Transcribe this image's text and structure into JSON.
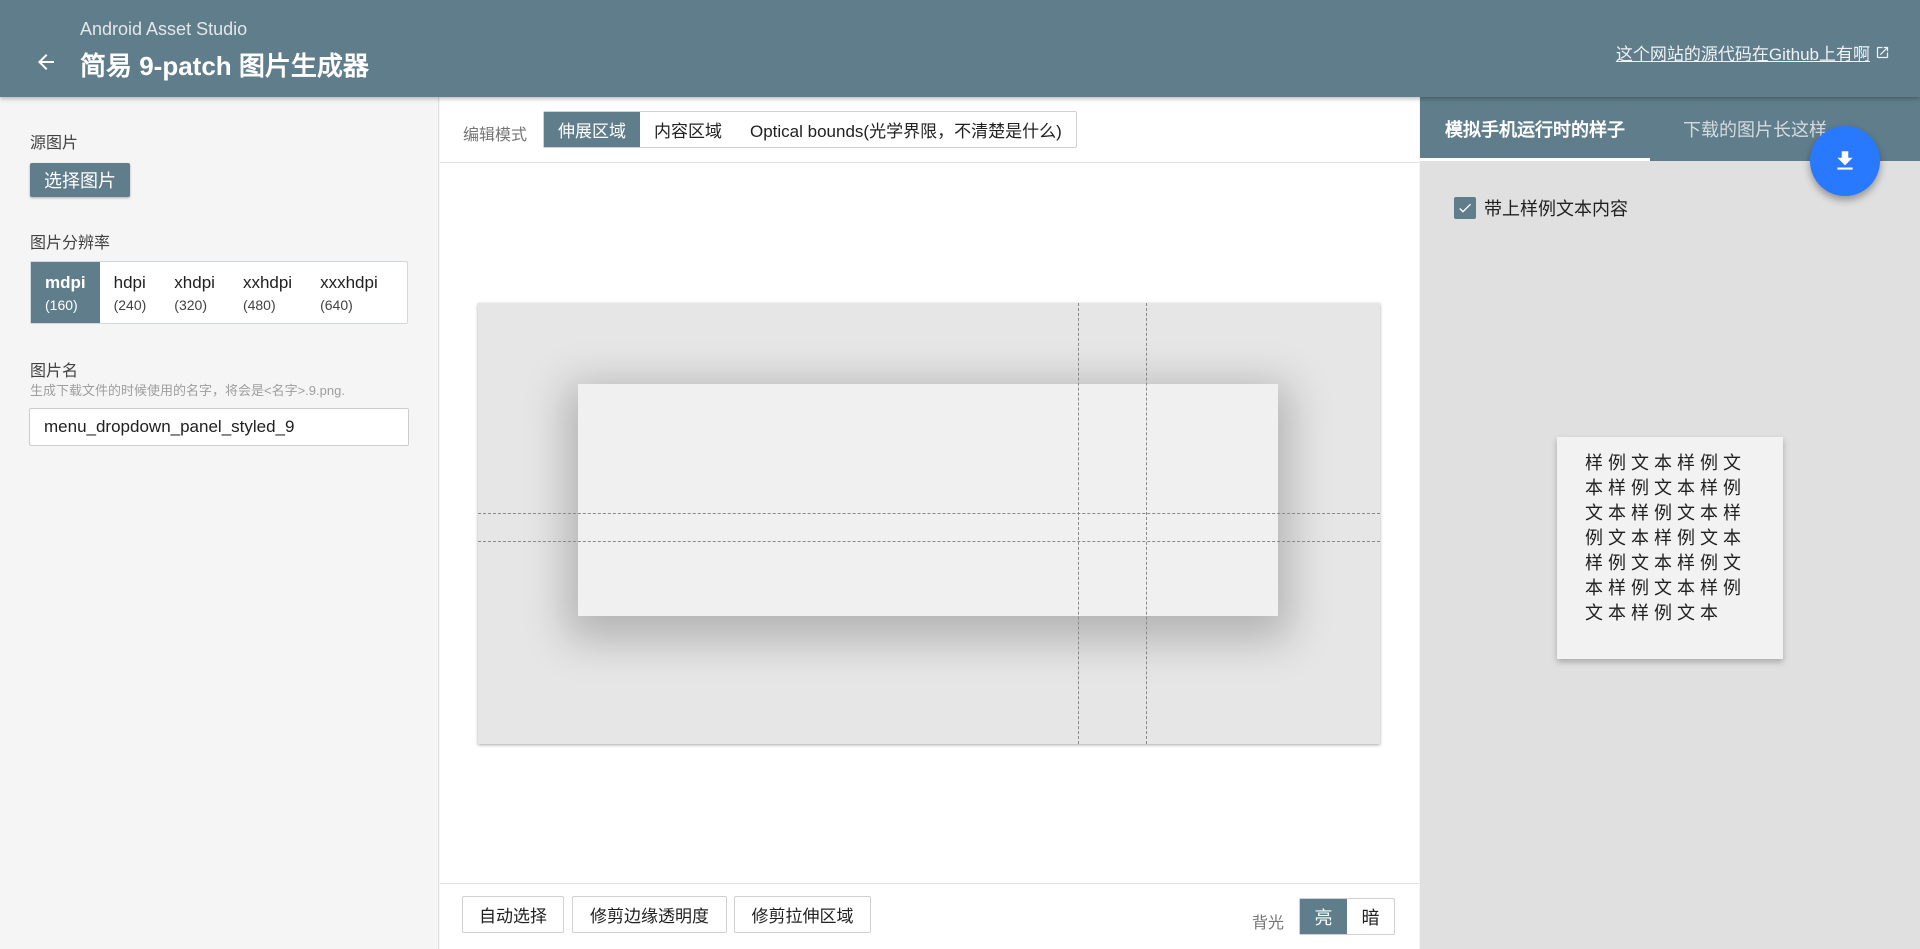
{
  "header": {
    "subtitle": "Android Asset Studio",
    "title": "简易 9-patch 图片生成器",
    "github_link": "这个网站的源代码在Github上有啊",
    "back_icon": "arrow-left-icon",
    "external_icon": "open-in-new-icon"
  },
  "left": {
    "source_label": "源图片",
    "select_button": "选择图片",
    "density_label": "图片分辨率",
    "densities": [
      {
        "name": "mdpi",
        "value": "(160)",
        "active": true
      },
      {
        "name": "hdpi",
        "value": "(240)",
        "active": false
      },
      {
        "name": "xhdpi",
        "value": "(320)",
        "active": false
      },
      {
        "name": "xxhdpi",
        "value": "(480)",
        "active": false
      },
      {
        "name": "xxxhdpi",
        "value": "(640)",
        "active": false
      }
    ],
    "name_label": "图片名",
    "name_hint": "生成下载文件的时候使用的名字，将会是<名字>.9.png.",
    "name_value": "menu_dropdown_panel_styled_9"
  },
  "center": {
    "edit_mode_label": "编辑模式",
    "modes": [
      {
        "label": "伸展区域",
        "active": true
      },
      {
        "label": "内容区域",
        "active": false
      },
      {
        "label": "Optical bounds(光学界限，不清楚是什么)",
        "active": false
      }
    ],
    "actions": {
      "auto_select": "自动选择",
      "trim_edge": "修剪边缘透明度",
      "trim_stretch": "修剪拉伸区域"
    },
    "background_label": "背光",
    "bg_light": "亮",
    "bg_dark": "暗"
  },
  "right": {
    "tab_preview": "模拟手机运行时的样子",
    "tab_download": "下载的图片长这样",
    "download_icon": "download-icon",
    "checkbox_label": "带上样例文本内容",
    "checkbox_checked": true,
    "sample_text": "样例文本样例文本样例文本样例文本样例文本样例文本样例文本样例文本样例文本样例文本样例文本样例文本"
  },
  "colors": {
    "primary": "#607d8b",
    "accent": "#2979ff"
  }
}
